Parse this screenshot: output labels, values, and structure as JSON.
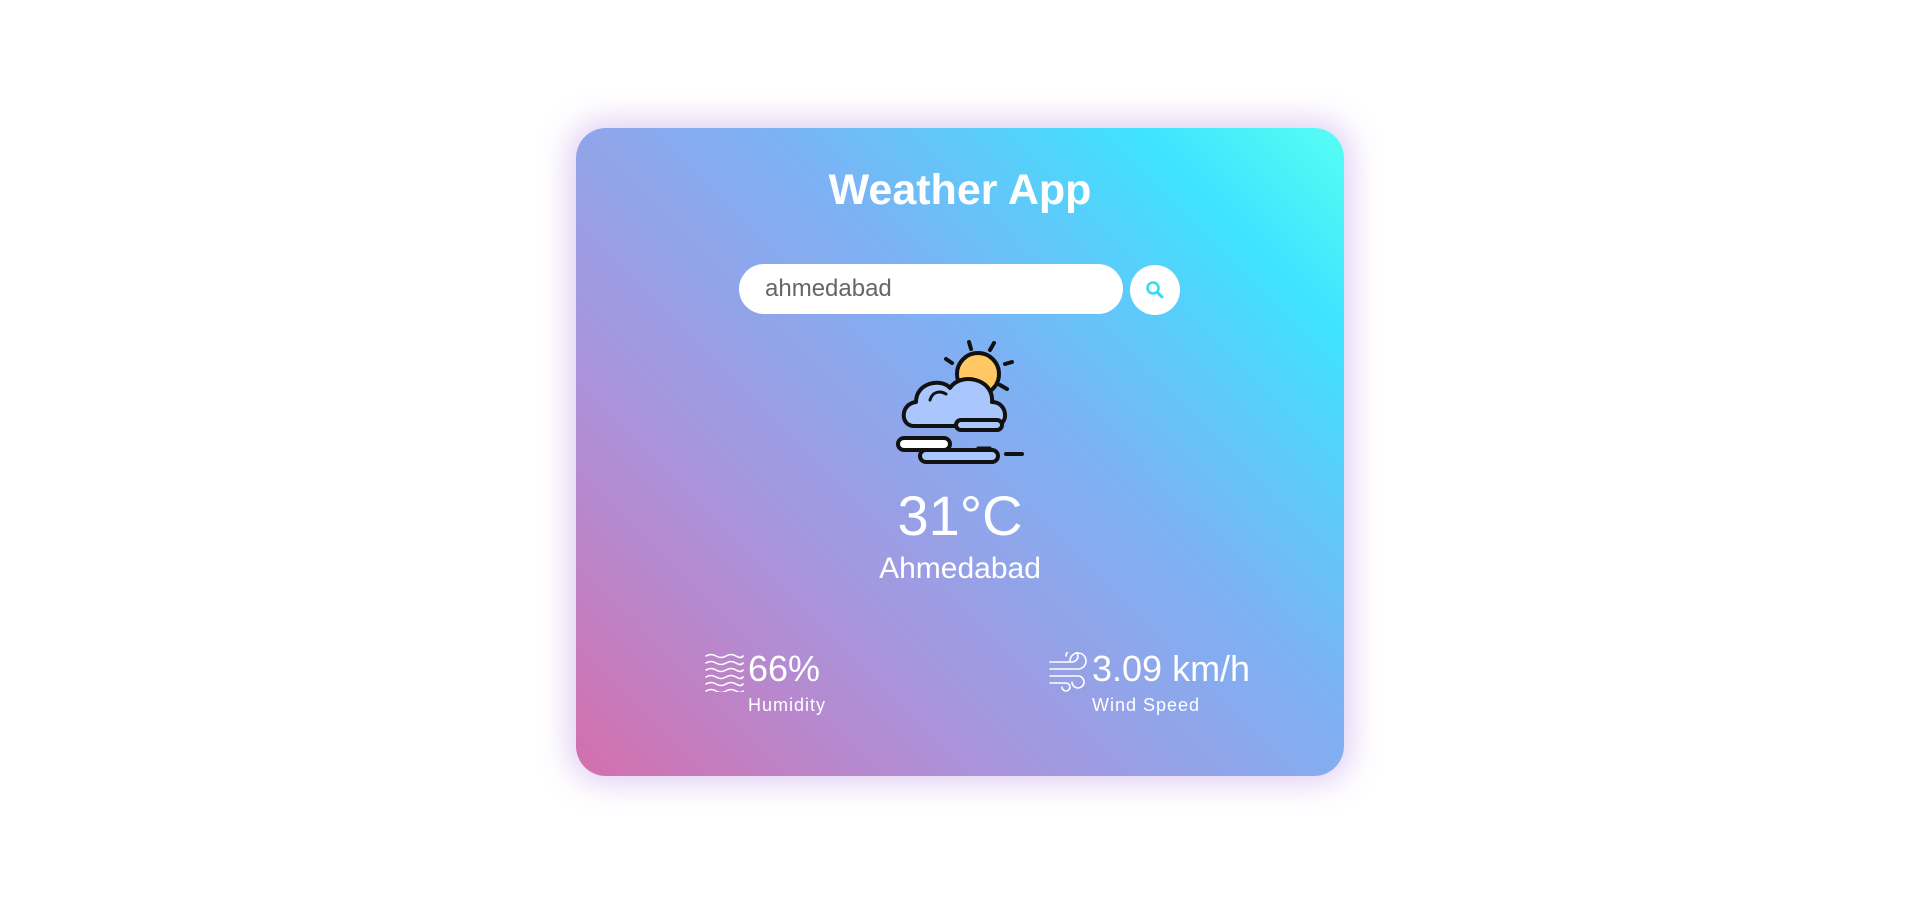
{
  "app": {
    "title": "Weather App"
  },
  "search": {
    "value": "ahmedabad",
    "button_icon": "search-icon"
  },
  "weather": {
    "condition_icon": "partly-cloudy-sun-icon",
    "temperature": "31°C",
    "city": "Ahmedabad"
  },
  "details": {
    "humidity": {
      "icon": "humidity-waves-icon",
      "value": "66%",
      "label": "Humidity"
    },
    "wind": {
      "icon": "wind-icon",
      "value": "3.09 km/h",
      "label": "Wind Speed"
    }
  },
  "colors": {
    "gradient_start": "#d46fad",
    "gradient_mid": "#7bb3f5",
    "gradient_end": "#55fff3",
    "search_icon": "#33dcf0",
    "sun": "#ffc863",
    "cloud": "#a9c7fd"
  }
}
